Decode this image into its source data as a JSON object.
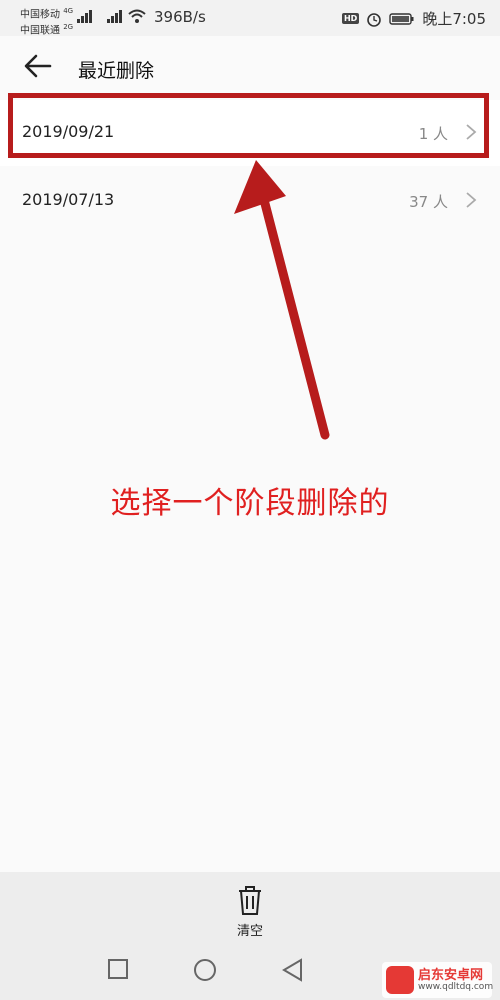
{
  "status_bar": {
    "carrier1": "中国移动",
    "carrier1_net": "4G",
    "carrier2": "中国联通",
    "carrier2_net": "2G",
    "speed": "396B/s",
    "hd": "HD",
    "time": "晚上7:05"
  },
  "header": {
    "title": "最近删除"
  },
  "rows": [
    {
      "date": "2019/09/21",
      "count": "1 人"
    },
    {
      "date": "2019/07/13",
      "count": "37 人"
    }
  ],
  "annotation": {
    "text": "选择一个阶段删除的"
  },
  "bottom": {
    "clear_label": "清空"
  },
  "watermark": {
    "title": "启东安卓网",
    "url": "www.qdltdq.com"
  },
  "colors": {
    "highlight": "#b71c1c",
    "annotation": "#e02020",
    "background": "#fafafa"
  }
}
